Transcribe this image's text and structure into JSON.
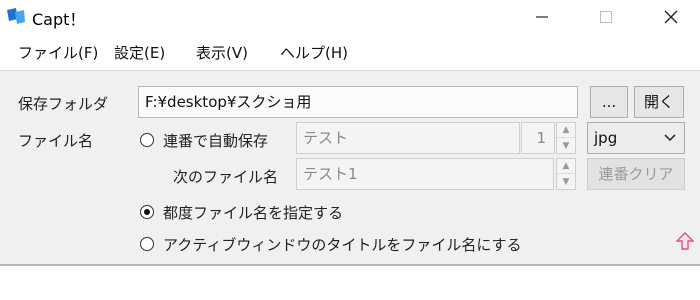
{
  "window": {
    "title": "Capt！",
    "icon": "capt-app-icon",
    "controls": {
      "minimize": "minimize-icon",
      "maximize": "maximize-icon",
      "close": "close-icon"
    }
  },
  "menu": [
    {
      "label": "ファイル(F)"
    },
    {
      "label": "設定(E)"
    },
    {
      "label": "表示(V)"
    },
    {
      "label": "ヘルプ(H)"
    }
  ],
  "save_folder": {
    "label": "保存フォルダ",
    "value": "F:¥desktop¥スクショ用",
    "browse_label": "...",
    "open_label": "開く"
  },
  "file_name": {
    "label": "ファイル名",
    "sequential": {
      "label": "連番で自動保存",
      "name_value": "テスト",
      "counter_value": "1",
      "format_selected": "jpg"
    },
    "next": {
      "label": "次のファイル名",
      "value": "テスト1",
      "clear_label": "連番クリア"
    },
    "specify_each_label": "都度ファイル名を指定する",
    "active_window_label": "アクティブウィンドウのタイトルをファイル名にする",
    "selected_option": "specify_each"
  },
  "colors": {
    "collapse_arrow": "#e0507a",
    "app_icon": "#1e73d2"
  }
}
